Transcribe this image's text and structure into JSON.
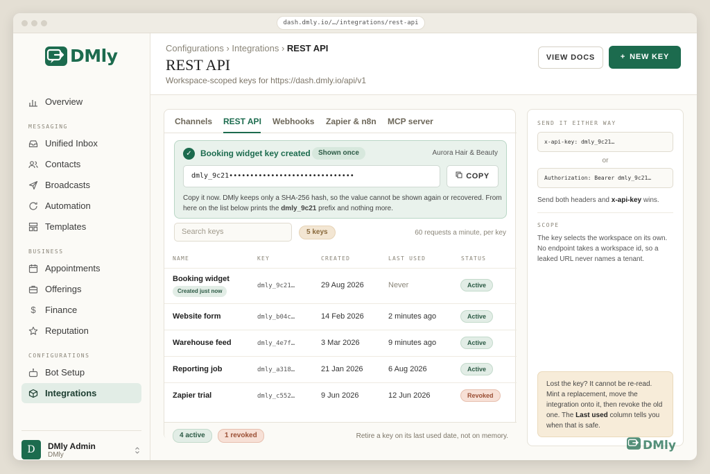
{
  "browser": {
    "url": "dash.dmly.io/…/integrations/rest-api"
  },
  "brand": {
    "name": "DMly",
    "color": "#1c6b4e"
  },
  "sidebar": {
    "overview": "Overview",
    "sections": {
      "messaging": "MESSAGING",
      "business": "BUSINESS",
      "configurations": "CONFIGURATIONS"
    },
    "items": {
      "unified_inbox": "Unified Inbox",
      "contacts": "Contacts",
      "broadcasts": "Broadcasts",
      "automation": "Automation",
      "templates": "Templates",
      "appointments": "Appointments",
      "offerings": "Offerings",
      "finance": "Finance",
      "reputation": "Reputation",
      "bot_setup": "Bot Setup",
      "integrations": "Integrations"
    },
    "user": {
      "initial": "D",
      "name": "DMly Admin",
      "role": "DMly"
    }
  },
  "header": {
    "breadcrumb": [
      "Configurations",
      "Integrations",
      "REST API"
    ],
    "title": "REST API",
    "subtitle": "Workspace-scoped keys for https://dash.dmly.io/api/v1",
    "view_docs": "VIEW DOCS",
    "new_key": "NEW KEY"
  },
  "tabs": [
    "Channels",
    "REST API",
    "Webhooks",
    "Zapier & n8n",
    "MCP server"
  ],
  "notice": {
    "title": "Booking widget key created",
    "badge": "Shown once",
    "workspace": "Aurora Hair & Beauty",
    "key": "dmly_9c21••••••••••••••••••••••••••••••",
    "copy": "COPY",
    "body_a": "Copy it now. DMly keeps only a SHA-256 hash, so the value cannot be shown again or recovered. From here on the list below prints the ",
    "body_prefix": "dmly_9c21",
    "body_b": " prefix and nothing more."
  },
  "toolbar": {
    "search_placeholder": "Search keys",
    "count": "5 keys",
    "rate": "60 requests a minute, per key"
  },
  "table": {
    "headers": [
      "NAME",
      "KEY",
      "CREATED",
      "LAST USED",
      "STATUS"
    ],
    "rows": [
      {
        "name": "Booking widget",
        "tag": "Created just now",
        "key": "dmly_9c21…",
        "created": "29 Aug 2026",
        "last_used": "Never",
        "status": "Active"
      },
      {
        "name": "Website form",
        "key": "dmly_b04c…",
        "created": "14 Feb 2026",
        "last_used": "2 minutes ago",
        "status": "Active"
      },
      {
        "name": "Warehouse feed",
        "key": "dmly_4e7f…",
        "created": "3 Mar 2026",
        "last_used": "9 minutes ago",
        "status": "Active"
      },
      {
        "name": "Reporting job",
        "key": "dmly_a318…",
        "created": "21 Jan 2026",
        "last_used": "6 Aug 2026",
        "status": "Active"
      },
      {
        "name": "Zapier trial",
        "key": "dmly_c552…",
        "created": "9 Jun 2026",
        "last_used": "12 Jun 2026",
        "status": "Revoked"
      }
    ]
  },
  "footer": {
    "active": "4 active",
    "revoked": "1 revoked",
    "note": "Retire a key on its last used date, not on memory."
  },
  "right": {
    "send_label": "SEND IT EITHER WAY",
    "header1": "x-api-key: dmly_9c21…",
    "or": "or",
    "header2": "Authorization: Bearer dmly_9c21…",
    "both_a": "Send both headers and ",
    "both_b": "x-api-key",
    "both_c": " wins.",
    "scope_label": "SCOPE",
    "scope_text": "The key selects the workspace on its own. No endpoint takes a workspace id, so a leaked URL never names a tenant.",
    "tip_a": "Lost the key? It cannot be re-read. Mint a replacement, move the integration onto it, then revoke the old one. The ",
    "tip_b": "Last used",
    "tip_c": " column tells you when that is safe."
  }
}
